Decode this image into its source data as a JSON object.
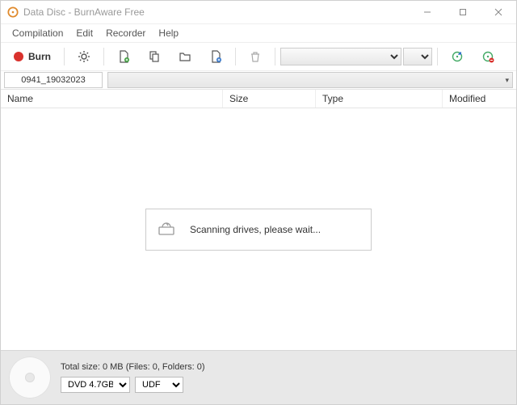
{
  "titlebar": {
    "title": "Data Disc - BurnAware Free"
  },
  "menu": {
    "compilation": "Compilation",
    "edit": "Edit",
    "recorder": "Recorder",
    "help": "Help"
  },
  "toolbar": {
    "burn_label": "Burn",
    "drive_selected": "",
    "speed_selected": ""
  },
  "disc": {
    "label": "0941_19032023"
  },
  "columns": {
    "name": "Name",
    "size": "Size",
    "type": "Type",
    "modified": "Modified"
  },
  "modal": {
    "message": "Scanning drives, please wait..."
  },
  "status": {
    "summary": "Total size: 0 MB (Files: 0, Folders: 0)",
    "media_selected": "DVD 4.7GB",
    "fs_selected": "UDF"
  }
}
